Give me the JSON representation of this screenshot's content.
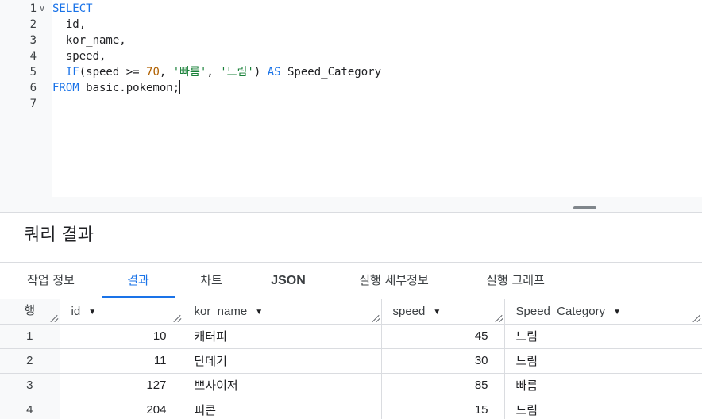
{
  "editor": {
    "lines": [
      {
        "n": "1",
        "parts": [
          [
            "kw",
            "SELECT"
          ]
        ]
      },
      {
        "n": "2",
        "parts": [
          [
            "id",
            "  id,"
          ]
        ]
      },
      {
        "n": "3",
        "parts": [
          [
            "id",
            "  kor_name,"
          ]
        ]
      },
      {
        "n": "4",
        "parts": [
          [
            "id",
            "  speed,"
          ]
        ]
      },
      {
        "n": "5",
        "parts": [
          [
            "id",
            "  "
          ],
          [
            "kw",
            "IF"
          ],
          [
            "id",
            "(speed >= "
          ],
          [
            "num",
            "70"
          ],
          [
            "id",
            ", "
          ],
          [
            "str",
            "'빠름'"
          ],
          [
            "id",
            ", "
          ],
          [
            "str",
            "'느림'"
          ],
          [
            "id",
            ") "
          ],
          [
            "kw",
            "AS"
          ],
          [
            "id",
            " Speed_Category"
          ]
        ]
      },
      {
        "n": "6",
        "parts": [
          [
            "kw",
            "FROM"
          ],
          [
            "id",
            " basic.pokemon;"
          ]
        ]
      },
      {
        "n": "7",
        "parts": []
      }
    ],
    "fold_icon": "chevron-down-icon",
    "colors": {
      "keyword": "#1a73e8",
      "number": "#b06000",
      "string": "#188038"
    }
  },
  "results": {
    "title": "쿼리 결과",
    "tabs": [
      "작업 정보",
      "결과",
      "차트",
      "JSON",
      "실행 세부정보",
      "실행 그래프"
    ],
    "active_tab": "결과",
    "accent_color": "#1a73e8"
  },
  "table": {
    "row_header": "행",
    "columns": [
      "id",
      "kor_name",
      "speed",
      "Speed_Category"
    ],
    "rows": [
      [
        "1",
        "10",
        "캐터피",
        "45",
        "느림"
      ],
      [
        "2",
        "11",
        "단데기",
        "30",
        "느림"
      ],
      [
        "3",
        "127",
        "쁘사이저",
        "85",
        "빠름"
      ],
      [
        "4",
        "204",
        "피콘",
        "15",
        "느림"
      ]
    ]
  }
}
